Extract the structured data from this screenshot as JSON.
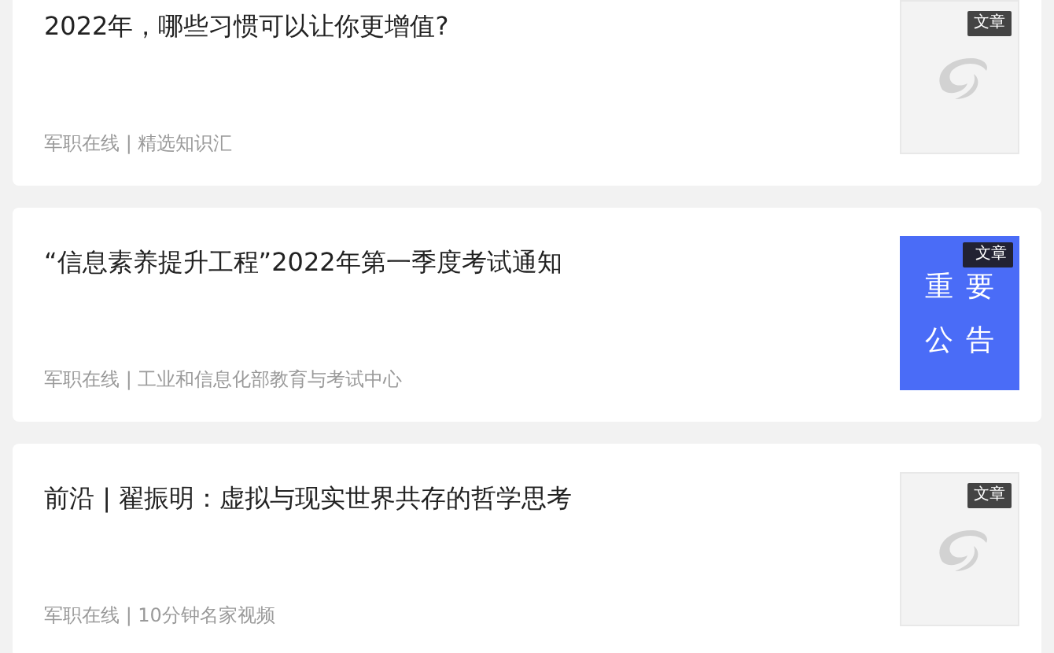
{
  "articles": [
    {
      "title": "2022年，哪些习惯可以让你更增值?",
      "meta": "军职在线 | 精选知识汇",
      "thumbnail": {
        "kind": "logo",
        "badge": "文章"
      }
    },
    {
      "title": "“信息素养提升工程”2022年第一季度考试通知",
      "meta": "军职在线 | 工业和信息化部教育与考试中心",
      "thumbnail": {
        "kind": "notice",
        "badge": "文章",
        "lines": [
          "重要",
          "公告"
        ]
      }
    },
    {
      "title": "前沿 | 翟振明：虚拟与现实世界共存的哲学思考",
      "meta": "军职在线 | 10分钟名家视频",
      "thumbnail": {
        "kind": "logo",
        "badge": "文章"
      }
    }
  ]
}
